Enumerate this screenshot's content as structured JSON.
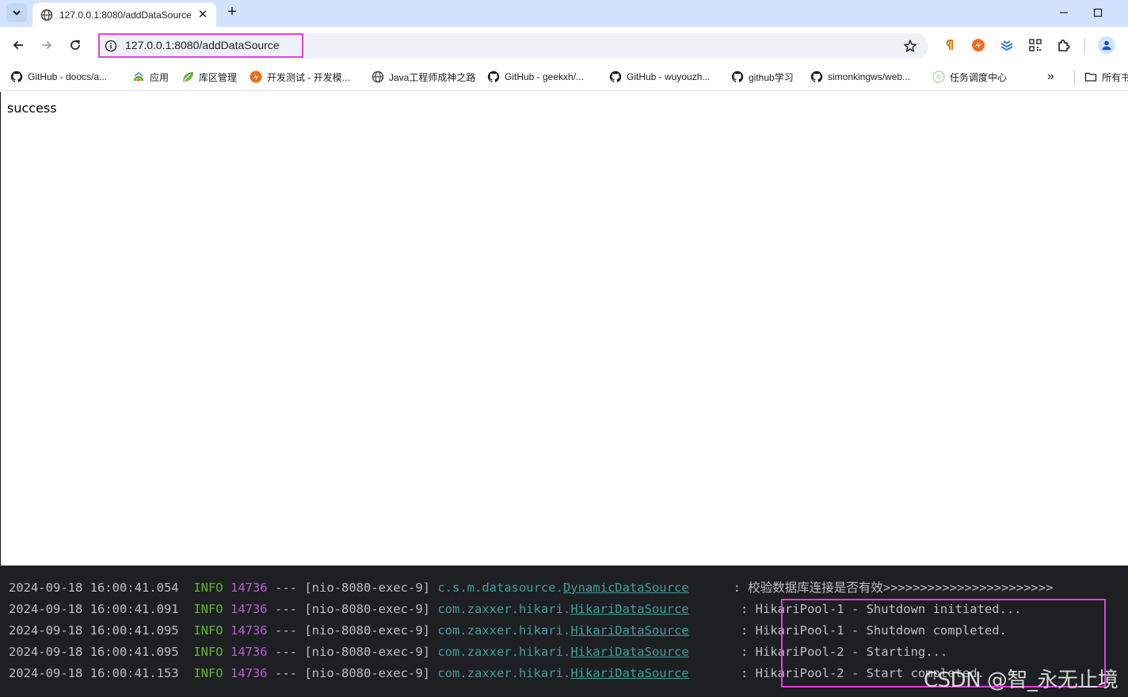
{
  "browser": {
    "tab": {
      "title": "127.0.0.1:8080/addDataSource",
      "close_glyph": "✕"
    },
    "new_tab_glyph": "+",
    "address": {
      "url": "127.0.0.1:8080/addDataSource"
    },
    "accent_color": "#d3e3fd",
    "highlight_color": "#e040e0"
  },
  "bookmarks": [
    {
      "label": "GitHub - doocs/a...",
      "icon": "github-icon"
    },
    {
      "label": "应用",
      "icon": "apps-icon"
    },
    {
      "label": "库区管理",
      "icon": "leaf-icon"
    },
    {
      "label": "开发测试 - 开发模...",
      "icon": "dev-icon"
    },
    {
      "label": "Java工程师成神之路",
      "icon": "globe-icon"
    },
    {
      "label": "GitHub - geekxh/...",
      "icon": "github-icon"
    },
    {
      "label": "GitHub - wuyouzh...",
      "icon": "github-icon"
    },
    {
      "label": "github学习",
      "icon": "github-icon"
    },
    {
      "label": "simonkingws/web...",
      "icon": "github-icon"
    },
    {
      "label": "任务调度中心",
      "icon": "xxl-icon"
    }
  ],
  "bookmarks_more": "»",
  "all_bookmarks_label": "所有书签",
  "page": {
    "body_text": "success"
  },
  "console": {
    "lines": [
      {
        "ts": "2024-09-18 16:00:41.054",
        "level": "INFO",
        "pid": "14736",
        "sep": "---",
        "thread": "[nio-8080-exec-9]",
        "pkg": "c.s.m.datasource.",
        "cls": "DynamicDataSource",
        "msg": ": 校验数据库连接是否有效>>>>>>>>>>>>>>>>>>>>>>>"
      },
      {
        "ts": "2024-09-18 16:00:41.091",
        "level": "INFO",
        "pid": "14736",
        "sep": "---",
        "thread": "[nio-8080-exec-9]",
        "pkg": "com.zaxxer.hikari.",
        "cls": "HikariDataSource",
        "msg": ": HikariPool-1 - Shutdown initiated..."
      },
      {
        "ts": "2024-09-18 16:00:41.095",
        "level": "INFO",
        "pid": "14736",
        "sep": "---",
        "thread": "[nio-8080-exec-9]",
        "pkg": "com.zaxxer.hikari.",
        "cls": "HikariDataSource",
        "msg": ": HikariPool-1 - Shutdown completed."
      },
      {
        "ts": "2024-09-18 16:00:41.095",
        "level": "INFO",
        "pid": "14736",
        "sep": "---",
        "thread": "[nio-8080-exec-9]",
        "pkg": "com.zaxxer.hikari.",
        "cls": "HikariDataSource",
        "msg": ": HikariPool-2 - Starting..."
      },
      {
        "ts": "2024-09-18 16:00:41.153",
        "level": "INFO",
        "pid": "14736",
        "sep": "---",
        "thread": "[nio-8080-exec-9]",
        "pkg": "com.zaxxer.hikari.",
        "cls": "HikariDataSource",
        "msg": ": HikariPool-2 - Start completed."
      }
    ],
    "watermark": "CSDN @智_永无止境"
  }
}
